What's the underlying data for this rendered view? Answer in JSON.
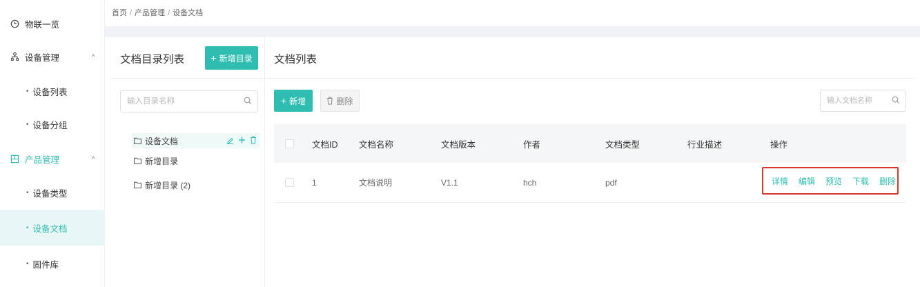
{
  "sidebar": {
    "items": [
      {
        "label": "物联一览",
        "icon": "clock-icon"
      },
      {
        "label": "设备管理",
        "icon": "tree-icon",
        "arrow": "^"
      },
      {
        "label": "设备列表"
      },
      {
        "label": "设备分组"
      },
      {
        "label": "产品管理",
        "icon": "box-icon",
        "arrow": "^"
      },
      {
        "label": "设备类型"
      },
      {
        "label": "设备文档"
      },
      {
        "label": "固件库"
      }
    ],
    "bullet": "•"
  },
  "breadcrumb": {
    "items": [
      "首页",
      "产品管理",
      "设备文档"
    ],
    "separator": "/"
  },
  "directory": {
    "title": "文档目录列表",
    "add_button": "新增目录",
    "search_placeholder": "输入目录名称",
    "nodes": [
      "设备文档",
      "新增目录",
      "新增目录 (2)"
    ]
  },
  "doc_list": {
    "title": "文档列表",
    "new_button": "新增",
    "delete_button": "删除",
    "search_placeholder": "输入文档名称",
    "columns": [
      "文档ID",
      "文档名称",
      "文档版本",
      "作者",
      "文档类型",
      "行业描述",
      "操作"
    ],
    "rows": [
      {
        "id": "1",
        "name": "文档说明",
        "version": "V1.1",
        "author": "hch",
        "type": "pdf",
        "desc": ""
      }
    ],
    "actions": [
      "详情",
      "编辑",
      "预览",
      "下载",
      "删除"
    ]
  },
  "colors": {
    "accent": "#2ebdb0",
    "highlight_border": "#d9362b"
  }
}
